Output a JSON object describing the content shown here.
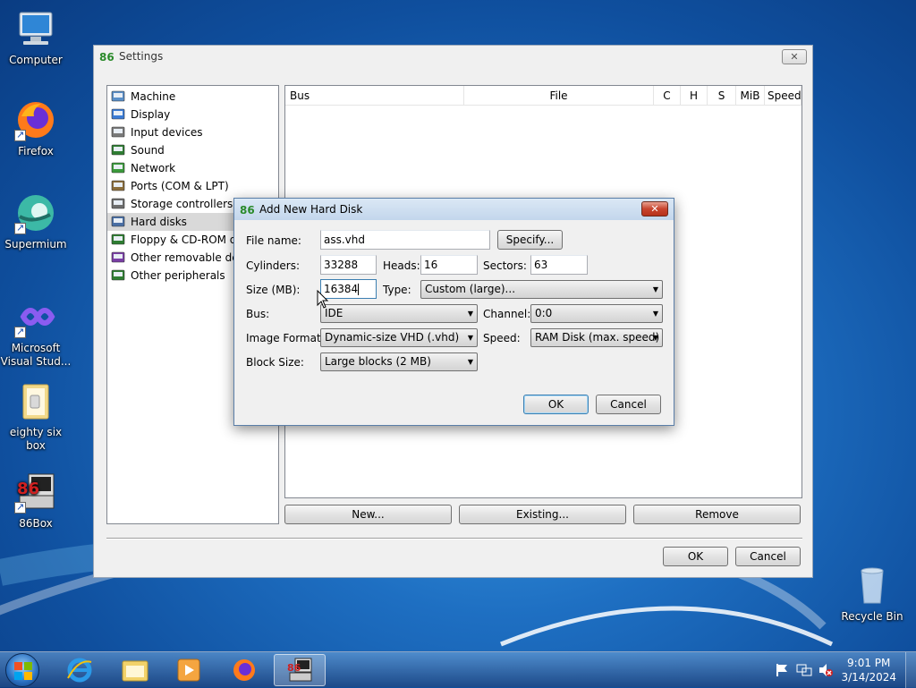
{
  "desktop": {
    "icons": [
      {
        "label": "Computer"
      },
      {
        "label": "Firefox"
      },
      {
        "label": "Supermium"
      },
      {
        "label": "Microsoft Visual Stud..."
      },
      {
        "label": "eighty six box"
      },
      {
        "label": "86Box"
      },
      {
        "label": "Recycle Bin"
      }
    ]
  },
  "settings": {
    "title": "Settings",
    "close": "✕",
    "categories": [
      {
        "label": "Machine",
        "icon": "machine-icon"
      },
      {
        "label": "Display",
        "icon": "display-icon"
      },
      {
        "label": "Input devices",
        "icon": "input-devices-icon"
      },
      {
        "label": "Sound",
        "icon": "sound-icon"
      },
      {
        "label": "Network",
        "icon": "network-icon"
      },
      {
        "label": "Ports (COM & LPT)",
        "icon": "ports-icon"
      },
      {
        "label": "Storage controllers",
        "icon": "storage-controllers-icon"
      },
      {
        "label": "Hard disks",
        "icon": "hard-disks-icon",
        "selected": true
      },
      {
        "label": "Floppy & CD-ROM drives",
        "icon": "floppy-cdrom-icon"
      },
      {
        "label": "Other removable devices",
        "icon": "removable-devices-icon"
      },
      {
        "label": "Other peripherals",
        "icon": "peripherals-icon"
      }
    ],
    "columns": [
      "Bus",
      "File",
      "C",
      "H",
      "S",
      "MiB",
      "Speed"
    ],
    "buttons": {
      "new": "New...",
      "existing": "Existing...",
      "remove": "Remove",
      "ok": "OK",
      "cancel": "Cancel"
    }
  },
  "dialog": {
    "title": "Add New Hard Disk",
    "close": "✕",
    "labels": {
      "file_name": "File name:",
      "cylinders": "Cylinders:",
      "heads": "Heads:",
      "sectors": "Sectors:",
      "size": "Size (MB):",
      "type": "Type:",
      "bus": "Bus:",
      "channel": "Channel:",
      "image_format": "Image Format:",
      "speed": "Speed:",
      "block_size": "Block Size:"
    },
    "values": {
      "file_name": "ass.vhd",
      "cylinders": "33288",
      "heads": "16",
      "sectors": "63",
      "size": "16384",
      "type": "Custom (large)...",
      "bus": "IDE",
      "channel": "0:0",
      "image_format": "Dynamic-size VHD (.vhd)",
      "speed": "RAM Disk (max. speed)",
      "block_size": "Large blocks (2 MB)"
    },
    "buttons": {
      "specify": "Specify...",
      "ok": "OK",
      "cancel": "Cancel"
    }
  },
  "taskbar": {
    "items": [
      "start-orb",
      "internet-explorer",
      "file-explorer",
      "media-player",
      "firefox",
      "86box"
    ],
    "time": "9:01 PM",
    "date": "3/14/2024"
  }
}
